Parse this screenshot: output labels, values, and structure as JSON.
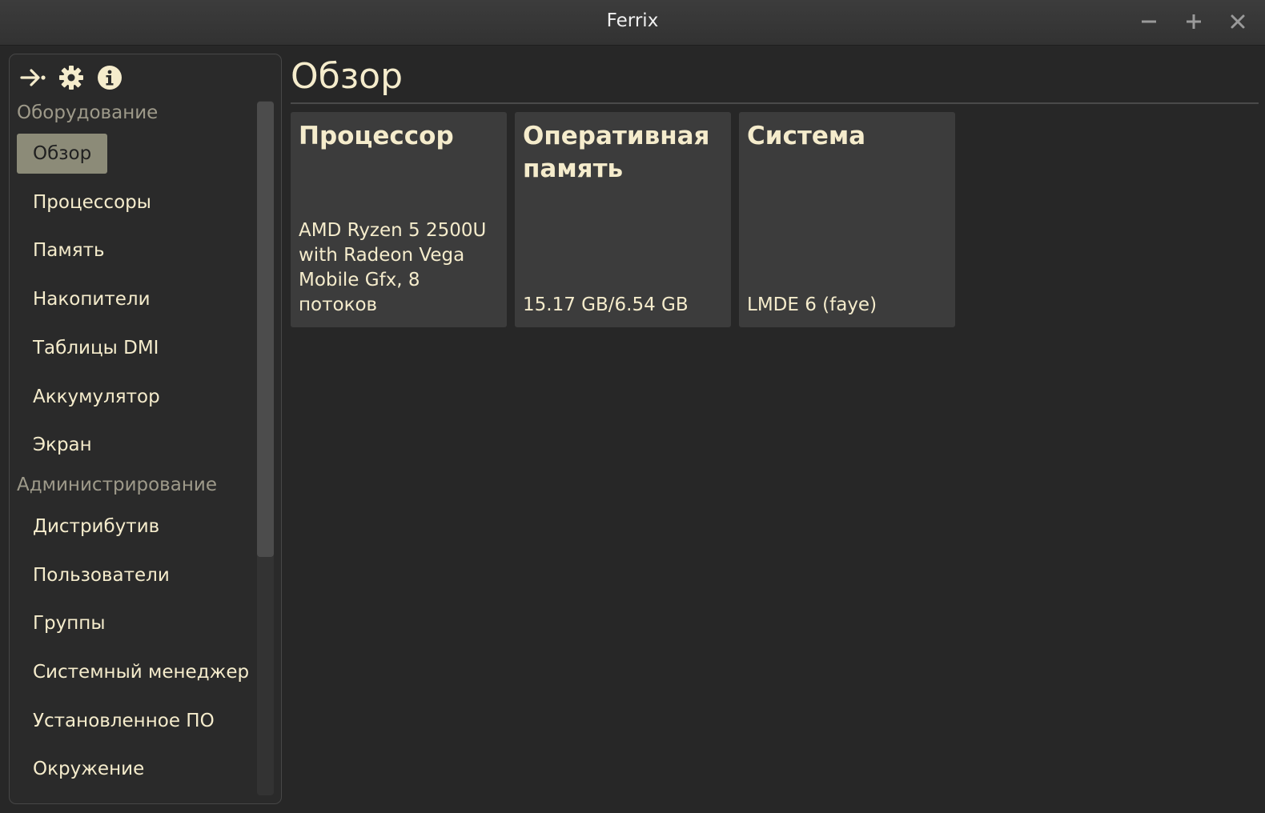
{
  "window": {
    "title": "Ferrix",
    "minimize_icon": "minus-icon",
    "maximize_icon": "plus-icon",
    "close_icon": "close-icon"
  },
  "toolbar": {
    "icons": [
      "collapse-arrow-icon",
      "gear-icon",
      "info-icon"
    ]
  },
  "sidebar": {
    "sections": [
      {
        "label": "Оборудование",
        "items": [
          "Обзор",
          "Процессоры",
          "Память",
          "Накопители",
          "Таблицы DMI",
          "Аккумулятор",
          "Экран"
        ]
      },
      {
        "label": "Администрирование",
        "items": [
          "Дистрибутив",
          "Пользователи",
          "Группы",
          "Системный менеджер",
          "Установленное ПО",
          "Окружение"
        ]
      }
    ],
    "selected": "Обзор"
  },
  "main": {
    "title": "Обзор",
    "cards": [
      {
        "title": "Процессор",
        "value": "AMD Ryzen 5 2500U with Radeon Vega Mobile Gfx, 8 потоков"
      },
      {
        "title": "Оперативная память",
        "value": "15.17 GB/6.54 GB"
      },
      {
        "title": "Система",
        "value": "LMDE 6 (faye)"
      }
    ]
  },
  "colors": {
    "background": "#272727",
    "text": "#f5eccc",
    "selected_item": "#8c8b78",
    "card": "#3c3c3c"
  }
}
